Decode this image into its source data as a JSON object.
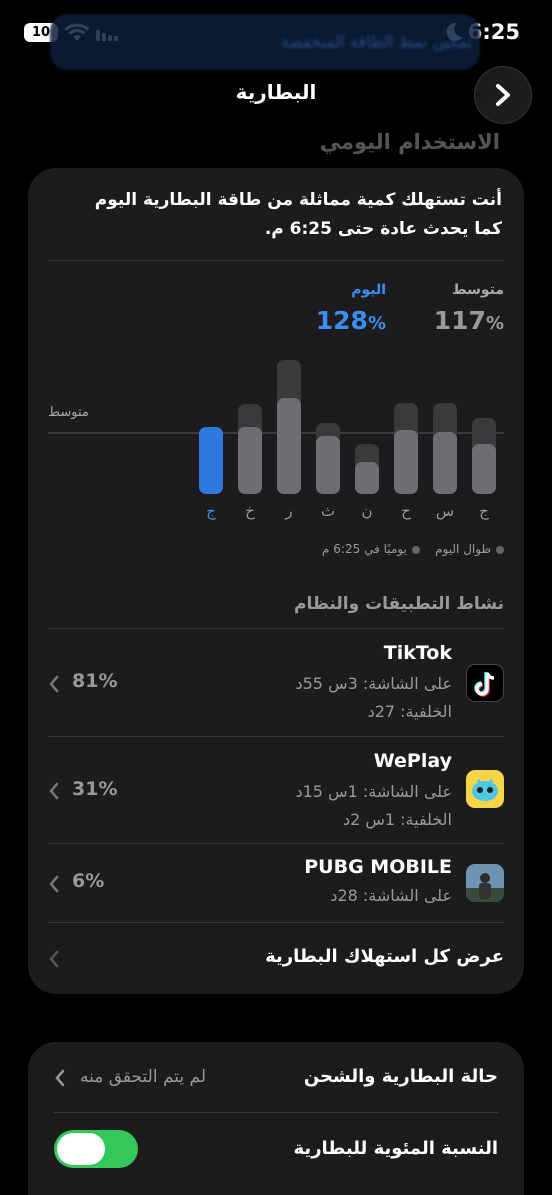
{
  "status_bar": {
    "time": "6:25",
    "battery_level": "10",
    "icons": [
      "battery-icon",
      "wifi-icon",
      "signal-icon",
      "moon-icon"
    ]
  },
  "banner": {
    "text": "تمكين نمط الطاقة المنخفضة"
  },
  "nav": {
    "title": "البطارية",
    "back_icon": "chevron-right-icon"
  },
  "section_title": "الاستخدام اليومي",
  "summary": "أنت تستهلك كمية مماثلة من طاقة البطارية اليوم كما يحدث عادة حتى 6:25 م.",
  "stats": {
    "average": {
      "label": "متوسط",
      "value": "117",
      "unit": "%"
    },
    "today": {
      "label": "اليوم",
      "value": "128",
      "unit": "%"
    }
  },
  "chart_data": {
    "type": "bar",
    "categories": [
      "ج",
      "س",
      "ح",
      "ن",
      "ث",
      "ر",
      "خ",
      "ج"
    ],
    "series": [
      {
        "values": [
          0.57,
          0.68,
          0.68,
          0.37,
          0.53,
          1.0,
          0.67,
          null
        ]
      },
      {
        "values": [
          0.37,
          0.46,
          0.48,
          0.24,
          0.43,
          0.72,
          0.5,
          0.5
        ]
      }
    ],
    "average_line_label": "متوسط",
    "average_line_value": 0.46,
    "today_index": 7,
    "colors": {
      "today": "#2f78e0",
      "bar": "#6e6e72",
      "bar_bg": "#3a3a3c"
    }
  },
  "legend": {
    "all_day": "طوال اليوم",
    "daily_until": "يوميًا في 6:25 م"
  },
  "activity": {
    "header": "نشاط التطبيقات والنظام",
    "apps": [
      {
        "name": "TikTok",
        "screen": "على الشاشة: 3س 55د",
        "background": "الخلفية: 27د",
        "percent": "81%",
        "icon": "tiktok-icon"
      },
      {
        "name": "WePlay",
        "screen": "على الشاشة: 1س 15د",
        "background": "الخلفية: 1س 2د",
        "percent": "31%",
        "icon": "weplay-icon"
      },
      {
        "name": "PUBG MOBILE",
        "screen": "على الشاشة: 28د",
        "percent": "6%",
        "icon": "pubg-icon"
      }
    ],
    "show_all": "عرض كل استهلاك البطارية"
  },
  "health": {
    "title": "حالة البطارية والشحن",
    "status": "لم يتم التحقق منه",
    "percentage_label": "النسبة المئوية للبطارية",
    "percentage_on": true
  }
}
